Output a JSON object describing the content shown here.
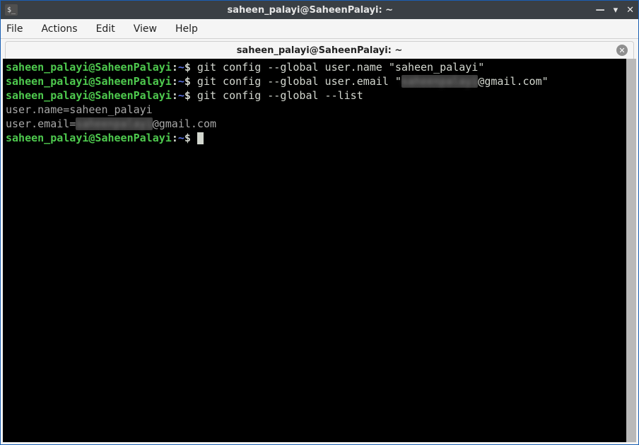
{
  "window": {
    "app_icon_text": "$_",
    "title": "saheen_palayi@SaheenPalayi: ~",
    "controls": {
      "min": "—",
      "max": "▾",
      "close": "✕"
    }
  },
  "menu": {
    "file": "File",
    "actions": "Actions",
    "edit": "Edit",
    "view": "View",
    "help": "Help"
  },
  "tab": {
    "label": "saheen_palayi@SaheenPalayi: ~",
    "close_symbol": "✕"
  },
  "prompt": {
    "user_host": "saheen_palayi@SaheenPalayi",
    "sep": ":",
    "path": "~",
    "symbol": "$"
  },
  "lines": {
    "cmd1": " git config --global user.name \"saheen_palayi\"",
    "cmd2_a": " git config --global user.email \"",
    "cmd2_email_local_hidden": "saheenpalayi",
    "cmd2_b": "@gmail.com\"",
    "cmd3": " git config --global --list",
    "out1": "user.name=saheen_palayi",
    "out2_a": "user.email=",
    "out2_hidden": "saheenpalayi",
    "out2_b": "@gmail.com"
  }
}
